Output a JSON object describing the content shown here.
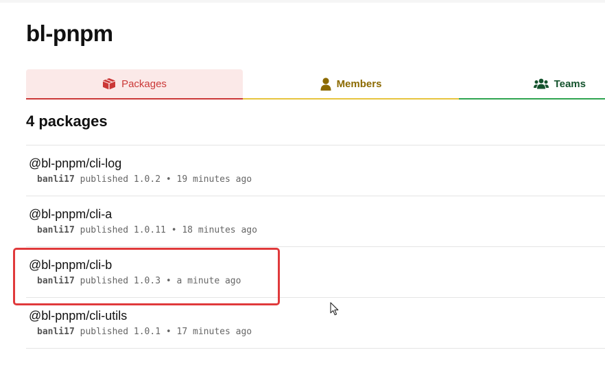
{
  "org": {
    "title": "bl-pnpm"
  },
  "tabs": [
    {
      "label": "Packages",
      "icon": "package-icon",
      "color": "#cb3837",
      "active": true
    },
    {
      "label": "Members",
      "icon": "user-icon",
      "color": "#8c6a00",
      "active": false
    },
    {
      "label": "Teams",
      "icon": "users-icon",
      "color": "#14532d",
      "active": false
    }
  ],
  "packages": {
    "count_label": "4 packages",
    "items": [
      {
        "name": "@bl-pnpm/cli-log",
        "author": "banli17",
        "published": "published",
        "version": "1.0.2",
        "separator": "•",
        "time": "19 minutes ago"
      },
      {
        "name": "@bl-pnpm/cli-a",
        "author": "banli17",
        "published": "published",
        "version": "1.0.11",
        "separator": "•",
        "time": "18 minutes ago"
      },
      {
        "name": "@bl-pnpm/cli-b",
        "author": "banli17",
        "published": "published",
        "version": "1.0.3",
        "separator": "•",
        "time": "a minute ago",
        "highlighted": true
      },
      {
        "name": "@bl-pnpm/cli-utils",
        "author": "banli17",
        "published": "published",
        "version": "1.0.1",
        "separator": "•",
        "time": "17 minutes ago"
      }
    ]
  },
  "annotation": {
    "highlight_color": "#e0393b"
  }
}
